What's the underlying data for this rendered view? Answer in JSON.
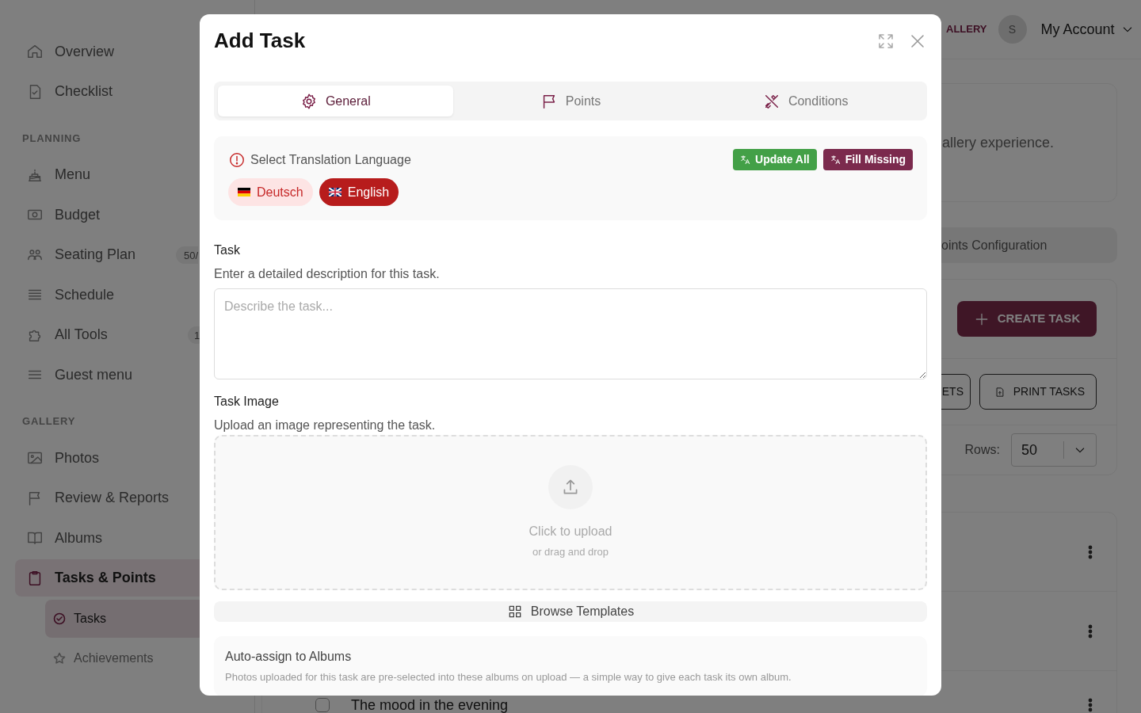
{
  "sidebar": {
    "sections": [
      {
        "items": [
          {
            "label": "Overview",
            "selected": false
          },
          {
            "label": "Checklist",
            "selected": false
          }
        ]
      },
      {
        "heading": "PLANNING",
        "items": [
          {
            "label": "Menu",
            "selected": false
          },
          {
            "label": "Budget",
            "selected": false
          },
          {
            "label": "Seating Plan",
            "selected": false,
            "badge": "50/"
          },
          {
            "label": "Schedule",
            "selected": false
          },
          {
            "label": "All Tools",
            "selected": false,
            "badge": "1"
          },
          {
            "label": "Guest menu",
            "selected": false
          }
        ]
      },
      {
        "heading": "GALLERY",
        "items": [
          {
            "label": "Photos",
            "selected": false
          },
          {
            "label": "Review & Reports",
            "selected": false
          },
          {
            "label": "Albums",
            "selected": false
          },
          {
            "label": "Tasks & Points",
            "selected": true,
            "expanded": true,
            "children": [
              {
                "label": "Tasks",
                "selected": true
              },
              {
                "label": "Achievements",
                "selected": false
              }
            ]
          }
        ]
      }
    ]
  },
  "topbar": {
    "nav_link": "ALLERY",
    "avatar_initial": "S",
    "account": "My Account"
  },
  "intro": {
    "text": "allery experience."
  },
  "points_config": {
    "label": "oints Configuration"
  },
  "toolbar": {
    "create_button": "CREATE TASK",
    "buttons": [
      "ETS",
      "PRINT TASKS"
    ],
    "rows_label": "Rows:",
    "rows_value": "50"
  },
  "task_rows": [
    {
      "title": ""
    },
    {
      "title": ""
    },
    {
      "title": "The mood in the evening",
      "checked": false
    }
  ],
  "modal": {
    "title": "Add Task",
    "tabs": [
      {
        "label": "General",
        "selected": true
      },
      {
        "label": "Points",
        "selected": false
      },
      {
        "label": "Conditions",
        "selected": false
      }
    ],
    "translation": {
      "label": "Select Translation Language",
      "actions": [
        {
          "label": "Update All",
          "kind": "update"
        },
        {
          "label": "Fill Missing",
          "kind": "fill"
        }
      ],
      "languages": [
        {
          "label": "Deutsch",
          "selected": false
        },
        {
          "label": "English",
          "selected": true
        }
      ]
    },
    "task": {
      "label": "Task",
      "hint": "Enter a detailed description for this task.",
      "placeholder": "Describe the task..."
    },
    "image": {
      "label": "Task Image",
      "hint": "Upload an image representing the task.",
      "upload": "Click to upload",
      "upload_hint": "or drag and drop"
    },
    "browse_button": "Browse Templates",
    "auto_assign": {
      "title": "Auto-assign to Albums",
      "text": "Photos uploaded for this task are pre-selected into these albums on upload — a simple way to give each task its own album."
    }
  }
}
